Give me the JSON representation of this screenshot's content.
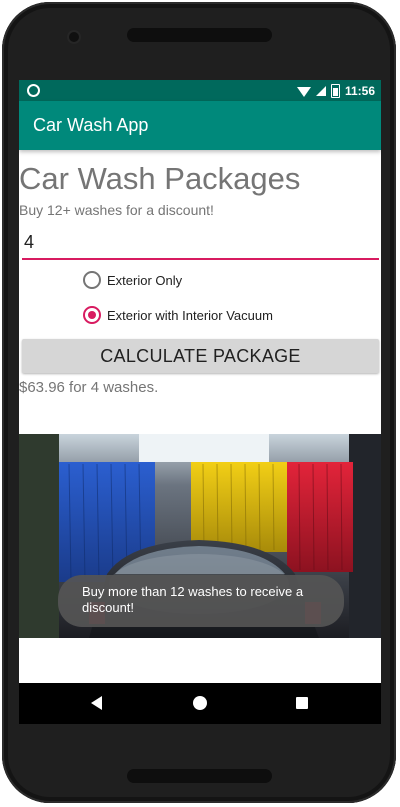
{
  "status_bar": {
    "time": "11:56"
  },
  "app_bar": {
    "title": "Car Wash App"
  },
  "main": {
    "title": "Car Wash Packages",
    "subtitle": "Buy 12+ washes for a discount!",
    "quantity_value": "4",
    "options": [
      {
        "label": "Exterior Only",
        "selected": false
      },
      {
        "label": "Exterior with Interior Vacuum",
        "selected": true
      }
    ],
    "calculate_label": "CALCULATE PACKAGE",
    "result": "$63.96 for 4 washes."
  },
  "toast": {
    "message": "Buy more than 12 washes to receive a discount!"
  },
  "colors": {
    "status_bar": "#00695c",
    "app_bar": "#00897b",
    "accent": "#d81b60",
    "button": "#d6d6d6"
  },
  "icons": {
    "status": [
      "status-dot-icon",
      "wifi-icon",
      "signal-icon",
      "battery-icon"
    ],
    "navigation": [
      "back-icon",
      "home-icon",
      "recents-icon"
    ]
  }
}
